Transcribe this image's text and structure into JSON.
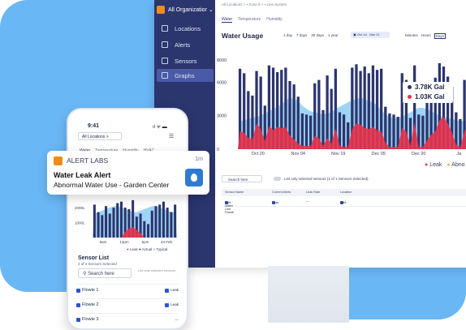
{
  "colors": {
    "navy": "#2b356e",
    "leak": "#e8334b",
    "typical": "#7fc4ee",
    "accent_orange": "#f08c1c",
    "brand_blue": "#6ab7f5"
  },
  "sidebar": {
    "org": "All Organizatior",
    "items": [
      {
        "label": "Locations",
        "icon": "building-icon"
      },
      {
        "label": "Alerts",
        "icon": "alert-icon"
      },
      {
        "label": "Sensors",
        "icon": "sensor-icon"
      },
      {
        "label": "Graphs",
        "icon": "graph-icon"
      }
    ]
  },
  "main": {
    "breadcrumb": "All Locations  >  ▪ Zone 8  >  ▪ Line System",
    "tabs": [
      "Water",
      "Temperature",
      "Humidity"
    ],
    "title": "Water Usage",
    "ranges": [
      "1 day",
      "7 days",
      "30 days",
      "1 year"
    ],
    "date_range": "▣  Oct 14 - Mar 21",
    "granularity": [
      "Minutes",
      "Hours",
      "Days"
    ],
    "legend": [
      {
        "label": "3.78K Gal",
        "color": "#2b356e"
      },
      {
        "label": "1.03K Gal",
        "color": "#e8334b"
      }
    ],
    "series_legend": {
      "leak": "Leak",
      "other": "Abno"
    },
    "list_controls": {
      "search": "Search here",
      "toggle_label": "List only selected sensors (1 of 1 Sensors Selected)"
    },
    "table": {
      "headers": [
        "Sensor Name",
        "Current Alerts",
        "Leak Rate",
        "Location"
      ],
      "rows": [
        [
          "Well Water Line Flowie",
          "Leak",
          "---",
          "Well"
        ]
      ]
    }
  },
  "phone": {
    "time": "9:41",
    "status": "ıl ᯤ ▬",
    "location": "All Locations  >",
    "tabs": [
      "Water",
      "Temperature",
      "Humidity",
      "HVAC"
    ],
    "legend": {
      "leak": "Leak",
      "actual": "Actual",
      "typical": "Typical"
    },
    "sensor_list_title": "Sensor List",
    "sensor_list_sub": "4 of 4 Sensors Selected",
    "search": "Search here",
    "toggle": "List only selected sensors",
    "rows": [
      {
        "name": "Flowie 1",
        "tag": "Leak"
      },
      {
        "name": "Flowie 2",
        "tag": "Leak"
      },
      {
        "name": "Flowie 3",
        "tag": "---"
      }
    ]
  },
  "notification": {
    "brand": "ALERT LABS",
    "time": "1m",
    "title": "Water Leak Alert",
    "body": "Abnormal Water Use - Garden Center"
  },
  "chart_data": [
    {
      "type": "bar",
      "title": "Water Usage",
      "ylabels": [
        "8000",
        "6000",
        "3000",
        "0"
      ],
      "x_ticks": [
        "Oct 20",
        "Nov 04",
        "Nov 19",
        "Dec 05",
        "Dec 20",
        "Ja"
      ],
      "ylim": [
        0,
        9000
      ],
      "series": [
        {
          "name": "3.78K Gal",
          "values": [
            7200,
            6800,
            5200,
            4800,
            7000,
            6500,
            3900,
            7500,
            7300,
            6900,
            7100,
            7300,
            6100,
            5800,
            4700,
            3200,
            3100,
            3000,
            5900,
            6200,
            3500,
            6600,
            5400,
            7200,
            3300,
            3100,
            2400,
            7300,
            7600,
            7000,
            7400,
            6800,
            7500,
            7100,
            7200,
            3800,
            3200,
            3100,
            2900,
            6800,
            6200,
            2800,
            7500,
            3100,
            3000,
            4700,
            5800,
            6400,
            7700,
            7400,
            6500,
            5600,
            3300,
            2700,
            6200,
            7200,
            7300,
            7500
          ]
        },
        {
          "name": "1.03K Gal",
          "values": [
            1600,
            1500,
            1000,
            900,
            2300,
            1800,
            700,
            2100,
            1700,
            2000,
            1900,
            2000,
            1200,
            900,
            500,
            300,
            300,
            300,
            1200,
            1000,
            300,
            1000,
            500,
            1900,
            300,
            200,
            200,
            1800,
            2300,
            2200,
            1900,
            1800,
            2000,
            1700,
            1600,
            600,
            200,
            200,
            200,
            1900,
            1600,
            300,
            2400,
            200,
            200,
            800,
            1300,
            1600,
            2600,
            2900,
            2300,
            1500,
            400,
            200,
            1600,
            2400,
            2100,
            1900
          ]
        },
        {
          "name": "Typical",
          "values": [
            2500,
            2600,
            2700,
            2800,
            2900,
            3000,
            3200,
            3400,
            3600,
            3800,
            4000,
            4400,
            4600,
            4500,
            4300,
            3900,
            3600,
            3400,
            3300,
            3200,
            3100,
            3200,
            3300,
            3600,
            3800,
            4000,
            4200,
            4400,
            4500,
            4600,
            4500,
            4300,
            4200,
            3900,
            3500,
            3100,
            2900,
            2800,
            2800,
            2900,
            3100,
            3300,
            3500,
            3700,
            3700,
            3600,
            3400,
            3200,
            3000,
            2900,
            2800,
            2700,
            2600,
            2500,
            2500,
            2600,
            2700,
            2800
          ]
        }
      ]
    },
    {
      "type": "bar",
      "title": "",
      "ylabels": [
        "2000L",
        "1000L"
      ],
      "x_ticks": [
        "6am",
        "12pm",
        "6pm",
        "24 Feb"
      ],
      "ylim": [
        0,
        2600
      ],
      "series": [
        {
          "name": "Actual",
          "values": [
            2200,
            1700,
            1500,
            2100,
            1600,
            2000,
            2300,
            2400,
            2000,
            1900,
            2500,
            1400,
            1600,
            1100,
            900,
            1800,
            2100,
            2200,
            2400,
            2000,
            1700,
            2200
          ]
        },
        {
          "name": "Leak",
          "values": [
            0,
            0,
            0,
            0,
            0,
            0,
            0,
            0,
            400,
            600,
            700,
            500,
            300,
            0,
            0,
            0,
            0,
            0,
            0,
            0,
            0,
            0
          ]
        },
        {
          "name": "Typical",
          "values": [
            1600,
            1700,
            1800,
            1900,
            2000,
            2100,
            2100,
            2000,
            1900,
            1800,
            1700,
            1700,
            1800,
            1900,
            2000,
            2100,
            2100,
            2000,
            1900,
            1800,
            1700,
            1700
          ]
        }
      ]
    }
  ]
}
